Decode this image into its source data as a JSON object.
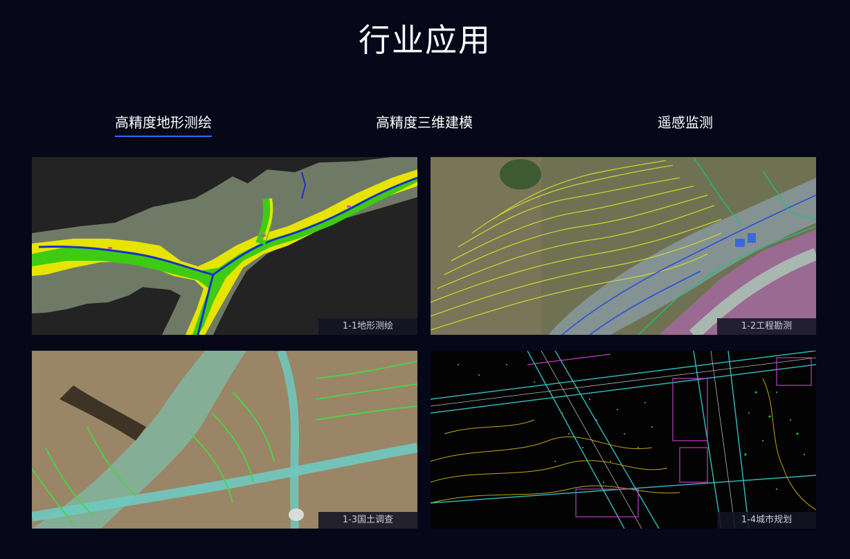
{
  "section": {
    "title": "行业应用"
  },
  "tabs": [
    {
      "label": "高精度地形测绘",
      "active": true
    },
    {
      "label": "高精度三维建模",
      "active": false
    },
    {
      "label": "遥感监测",
      "active": false
    }
  ],
  "gallery": [
    {
      "caption": "1-1地形测绘"
    },
    {
      "caption": "1-2工程勘测"
    },
    {
      "caption": "1-3国土调查"
    },
    {
      "caption": "1-4城市规划"
    }
  ],
  "colors": {
    "background": "#060819",
    "accent": "#2f6cf6"
  }
}
